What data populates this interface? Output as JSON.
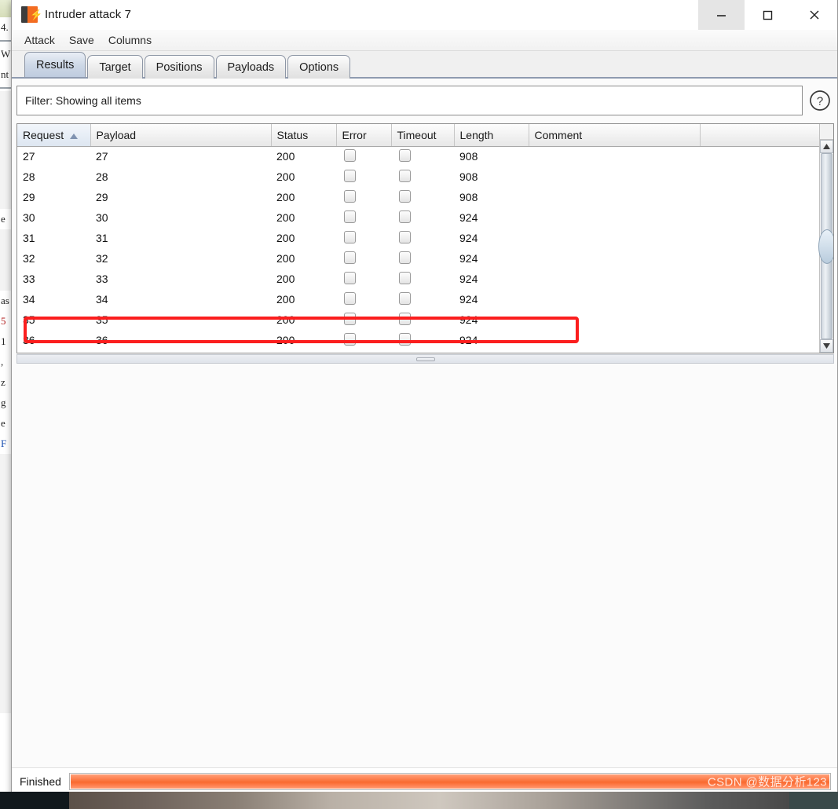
{
  "window": {
    "title": "Intruder attack 7",
    "icon": "burp-suite-icon",
    "controls": {
      "minimize": "—",
      "maximize": "□",
      "close": "✕"
    }
  },
  "menu": {
    "items": [
      {
        "label": "Attack"
      },
      {
        "label": "Save"
      },
      {
        "label": "Columns"
      }
    ]
  },
  "tabs": [
    {
      "label": "Results",
      "active": true
    },
    {
      "label": "Target",
      "active": false
    },
    {
      "label": "Positions",
      "active": false
    },
    {
      "label": "Payloads",
      "active": false
    },
    {
      "label": "Options",
      "active": false
    }
  ],
  "filter": {
    "text": "Filter: Showing all items",
    "help_icon": "question-mark-icon"
  },
  "table": {
    "sort_column": "Request",
    "sort_direction": "ascending",
    "columns": [
      {
        "key": "request",
        "label": "Request"
      },
      {
        "key": "payload",
        "label": "Payload"
      },
      {
        "key": "status",
        "label": "Status"
      },
      {
        "key": "error",
        "label": "Error"
      },
      {
        "key": "timeout",
        "label": "Timeout"
      },
      {
        "key": "length",
        "label": "Length"
      },
      {
        "key": "comment",
        "label": "Comment"
      }
    ],
    "rows": [
      {
        "request": "27",
        "payload": "27",
        "status": "200",
        "error": false,
        "timeout": false,
        "length": "908",
        "comment": "",
        "highlighted": false
      },
      {
        "request": "28",
        "payload": "28",
        "status": "200",
        "error": false,
        "timeout": false,
        "length": "908",
        "comment": "",
        "highlighted": false
      },
      {
        "request": "29",
        "payload": "29",
        "status": "200",
        "error": false,
        "timeout": false,
        "length": "908",
        "comment": "",
        "highlighted": true
      },
      {
        "request": "30",
        "payload": "30",
        "status": "200",
        "error": false,
        "timeout": false,
        "length": "924",
        "comment": "",
        "highlighted": false
      },
      {
        "request": "31",
        "payload": "31",
        "status": "200",
        "error": false,
        "timeout": false,
        "length": "924",
        "comment": "",
        "highlighted": false
      },
      {
        "request": "32",
        "payload": "32",
        "status": "200",
        "error": false,
        "timeout": false,
        "length": "924",
        "comment": "",
        "highlighted": false
      },
      {
        "request": "33",
        "payload": "33",
        "status": "200",
        "error": false,
        "timeout": false,
        "length": "924",
        "comment": "",
        "highlighted": false
      },
      {
        "request": "34",
        "payload": "34",
        "status": "200",
        "error": false,
        "timeout": false,
        "length": "924",
        "comment": "",
        "highlighted": false
      },
      {
        "request": "35",
        "payload": "35",
        "status": "200",
        "error": false,
        "timeout": false,
        "length": "924",
        "comment": "",
        "highlighted": false
      },
      {
        "request": "36",
        "payload": "36",
        "status": "200",
        "error": false,
        "timeout": false,
        "length": "924",
        "comment": "",
        "highlighted": false
      }
    ]
  },
  "status_bar": {
    "text": "Finished",
    "progress_percent": 100
  },
  "watermark": {
    "text": "CSDN @数据分析123"
  },
  "annotation": {
    "color": "#fb1e1e",
    "target_row": "29"
  },
  "background_window": {
    "lines": [
      "4.",
      "W",
      "nt",
      "e",
      "as",
      "5",
      "1",
      ",",
      "z",
      "g",
      "e",
      "F"
    ]
  },
  "colors": {
    "accent_orange": "#f36c21",
    "progress_orange": "#f96a30",
    "annotation_red": "#fb1e1e",
    "tab_active": "#ccd7e6"
  }
}
